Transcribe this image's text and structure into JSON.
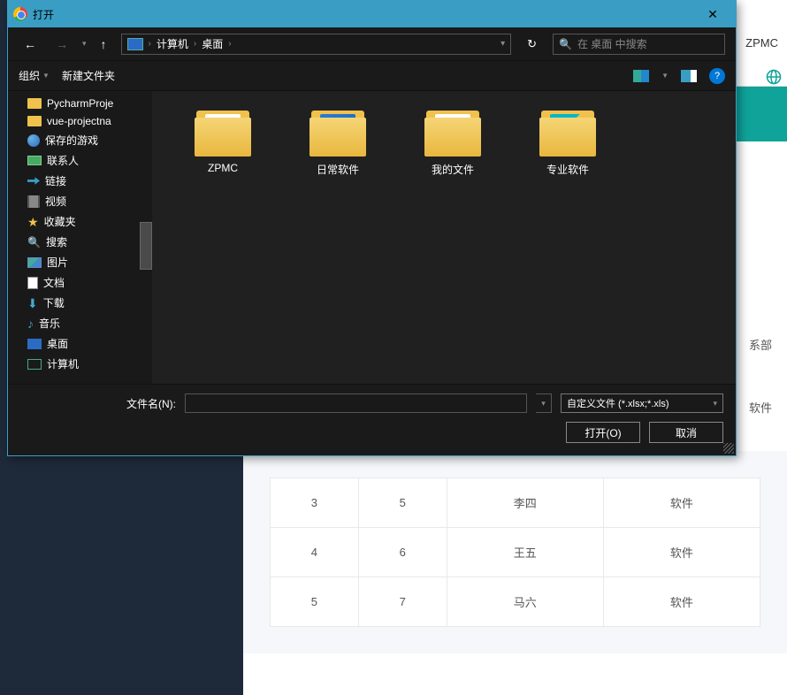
{
  "dialog": {
    "title": "打开",
    "breadcrumb": {
      "root": "计算机",
      "current": "桌面"
    },
    "search_placeholder": "在 桌面 中搜索",
    "toolbar": {
      "organize": "组织",
      "newfolder": "新建文件夹"
    },
    "tree": [
      {
        "icon": "folder",
        "label": "PycharmProje"
      },
      {
        "icon": "folder",
        "label": "vue-projectna"
      },
      {
        "icon": "globe",
        "label": "保存的游戏"
      },
      {
        "icon": "card",
        "label": "联系人"
      },
      {
        "icon": "link",
        "label": "链接"
      },
      {
        "icon": "film",
        "label": "视频"
      },
      {
        "icon": "star",
        "label": "收藏夹"
      },
      {
        "icon": "search",
        "label": "搜索"
      },
      {
        "icon": "pic",
        "label": "图片"
      },
      {
        "icon": "doc",
        "label": "文档"
      },
      {
        "icon": "down",
        "label": "下载"
      },
      {
        "icon": "music",
        "label": "音乐"
      },
      {
        "icon": "monitor",
        "label": "桌面"
      },
      {
        "icon": "comp",
        "label": "计算机"
      }
    ],
    "folders": [
      {
        "style": "ppt",
        "label": "ZPMC"
      },
      {
        "style": "blue",
        "label": "日常软件"
      },
      {
        "style": "docs",
        "label": "我的文件"
      },
      {
        "style": "ws",
        "label": "专业软件"
      }
    ],
    "filename_label": "文件名(N):",
    "filename_value": "",
    "filetype": "自定义文件 (*.xlsx;*.xls)",
    "open_btn": "打开(O)",
    "cancel_btn": "取消"
  },
  "bg": {
    "header_badge": "ZPMC",
    "side_label_top": "系部",
    "tail_labels": [
      "软件",
      "软件",
      "软件",
      "软件"
    ],
    "table": [
      {
        "c1": "3",
        "c2": "5",
        "c3": "李四",
        "c4": "软件"
      },
      {
        "c1": "4",
        "c2": "6",
        "c3": "王五",
        "c4": "软件"
      },
      {
        "c1": "5",
        "c2": "7",
        "c3": "马六",
        "c4": "软件"
      }
    ]
  }
}
